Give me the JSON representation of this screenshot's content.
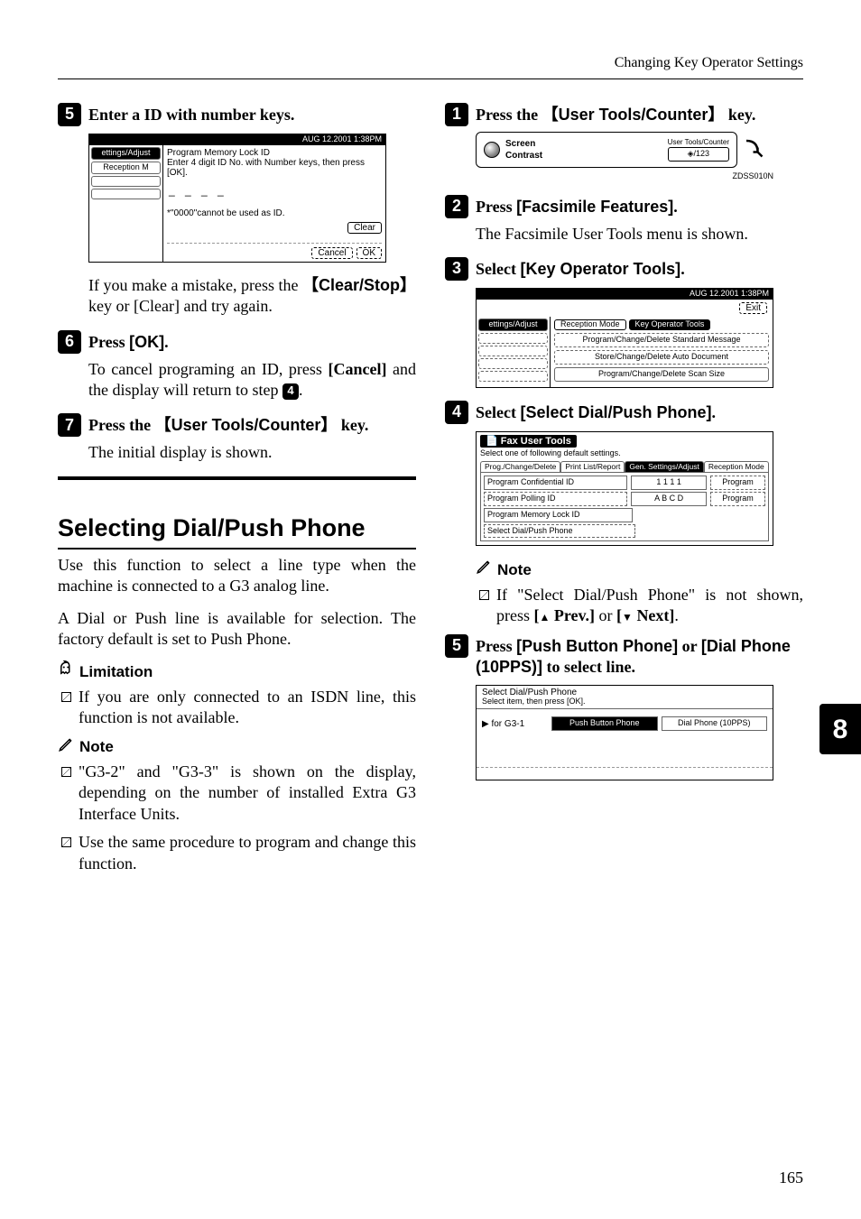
{
  "running_head": "Changing Key Operator Settings",
  "page_number": "165",
  "side_tab": "8",
  "left": {
    "step5": {
      "num": "5",
      "text_prefix": "Enter a ID with number keys."
    },
    "shot1": {
      "date": "AUG   12.2001   1:38PM",
      "tab_a": "ettings/Adjust",
      "tab_b": "Reception M",
      "title": "Program Memory Lock ID",
      "instr": "Enter 4 digit ID No. with Number keys, then press [OK].",
      "field": "_ _ _ _",
      "note": "*\"0000\"cannot be used as ID.",
      "btn_clear": "Clear",
      "btn_cancel": "Cancel",
      "btn_ok": "OK"
    },
    "after5": "If you make a mistake, press the {{Clear/Stop}} key or [Clear] and try again.",
    "step6": {
      "num": "6",
      "text": "Press [OK]."
    },
    "after6": "To cancel programing an ID, press [Cancel] and the display will return to step 4.",
    "step7": {
      "num": "7",
      "text": "Press the {{User Tools/Counter}} key."
    },
    "after7": "The initial display is shown.",
    "section_title": "Selecting Dial/Push Phone",
    "para1": "Use this function to select a line type when the machine is connected to a G3 analog line.",
    "para2": "A Dial or Push line is available for selection. The factory default is set to Push Phone.",
    "limitation_label": "Limitation",
    "limitation_item": "If you are only connected to an ISDN line, this function is not available.",
    "note_label": "Note",
    "note_items": [
      "\"G3-2\" and \"G3-3\" is shown on the display, depending on the number of installed Extra G3 Interface Units.",
      "Use the same procedure to program and change this function."
    ]
  },
  "right": {
    "step1": {
      "num": "1",
      "text": "Press the {{User Tools/Counter}} key."
    },
    "sc_panel": {
      "left_label1": "Screen",
      "left_label2": "Contrast",
      "utc_top": "User Tools/Counter",
      "utc_icon": "◈/123",
      "code": "ZDSS010N"
    },
    "step2": {
      "num": "2",
      "text": "Press [Facsimile Features]."
    },
    "after2": "The Facsimile User Tools menu is shown.",
    "step3": {
      "num": "3",
      "text": "Select [Key Operator Tools]."
    },
    "shot3": {
      "date": "AUG   12.2001   1:38PM",
      "btn_exit": "Exit",
      "tab_a": "ettings/Adjust",
      "tab_b": "Reception Mode",
      "tab_c": "Key Operator Tools",
      "rows": [
        "Program/Change/Delete Standard Message",
        "Store/Change/Delete Auto Document",
        "Program/Change/Delete Scan Size"
      ]
    },
    "step4": {
      "num": "4",
      "text": "Select [Select Dial/Push Phone]."
    },
    "shot4": {
      "title": "Fax User Tools",
      "sub": "Select one of following default settings.",
      "tabs": [
        "Prog./Change/Delete",
        "Print List/Report",
        "Gen. Settings/Adjust",
        "Reception Mode"
      ],
      "row1": {
        "a": "Program Confidential ID",
        "b": "1 1 1 1",
        "c": "Program"
      },
      "row2": {
        "a": "Program Polling ID",
        "b": "A B C D",
        "c": "Program"
      },
      "row3": {
        "a": "Program Memory Lock ID",
        "b": "",
        "c": ""
      },
      "row4": {
        "a": "Select Dial/Push Phone",
        "b": "",
        "c": ""
      }
    },
    "note_label": "Note",
    "note_item": "If \"Select Dial/Push Phone\" is not shown, press [▲ Prev.] or [▼ Next].",
    "note_item_prefix": "If \"Select Dial/Push Phone\" is not shown, press ",
    "note_item_mid": " or ",
    "note_item_end": ".",
    "btn_prev": "Prev.",
    "btn_next": "Next",
    "step5": {
      "num": "5",
      "text": "Press [Push Button Phone] or [Dial Phone (10PPS)] to select line."
    },
    "shot5": {
      "title": "Select Dial/Push Phone",
      "sub": "Select item, then press [OK].",
      "arrow_label": "for G3-1",
      "btn_push": "Push Button Phone",
      "btn_dial": "Dial Phone (10PPS)"
    }
  }
}
